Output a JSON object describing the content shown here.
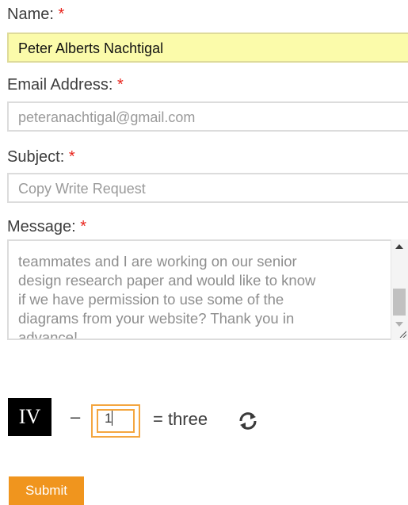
{
  "form": {
    "name": {
      "label": "Name:",
      "required_mark": "*",
      "value": "Peter Alberts Nachtigal"
    },
    "email": {
      "label": "Email Address:",
      "required_mark": "*",
      "value": "peteranachtigal@gmail.com"
    },
    "subject": {
      "label": "Subject:",
      "required_mark": "*",
      "value": "Copy Write Request"
    },
    "message": {
      "label": "Message:",
      "required_mark": "*",
      "visible_lines": [
        "teammates and I are working on our senior",
        "design research paper and would like to know",
        "if we have permission to use some of the",
        "diagrams from your website? Thank you in",
        "advance!"
      ]
    },
    "captcha": {
      "roman_numeral": "IV",
      "operator": "–",
      "answer_value": "1",
      "equals_text": "= three"
    },
    "submit_label": "Submit"
  },
  "colors": {
    "required": "#e8231b",
    "name_field_bg": "#fbfbaa",
    "captcha_focus": "#f4a640",
    "submit_bg": "#f0951e"
  },
  "icons": {
    "refresh": "refresh-icon"
  }
}
